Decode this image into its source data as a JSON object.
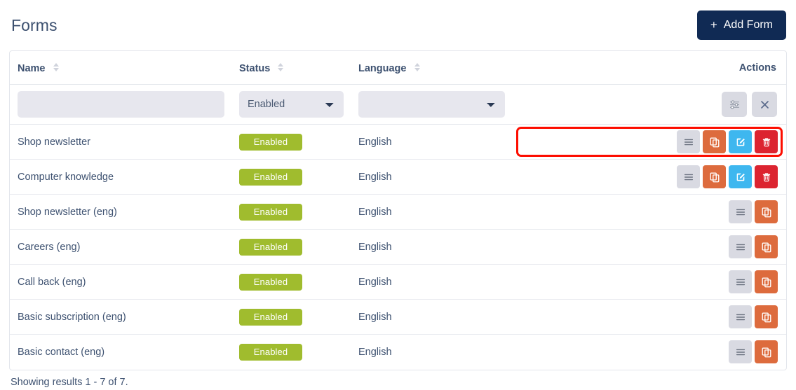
{
  "header": {
    "title": "Forms",
    "add_button": {
      "label": "Add Form",
      "plus": "+",
      "color": "#102a54"
    }
  },
  "table": {
    "columns": [
      {
        "key": "name",
        "label": "Name",
        "sortable": true
      },
      {
        "key": "status",
        "label": "Status",
        "sortable": true
      },
      {
        "key": "language",
        "label": "Language",
        "sortable": true
      },
      {
        "key": "actions",
        "label": "Actions",
        "sortable": false
      }
    ],
    "filters": {
      "name": {
        "value": "",
        "placeholder": ""
      },
      "status": {
        "value": "Enabled",
        "options": [
          "Enabled"
        ]
      },
      "language": {
        "value": "",
        "options": [
          ""
        ]
      },
      "apply_button_icon": "sliders-icon",
      "clear_button_icon": "close-icon"
    },
    "rows": [
      {
        "name": "Shop newsletter",
        "status": "Enabled",
        "language": "English",
        "highlighted": true,
        "actions": [
          "menu",
          "copy",
          "edit",
          "delete"
        ]
      },
      {
        "name": "Computer knowledge",
        "status": "Enabled",
        "language": "English",
        "highlighted": false,
        "actions": [
          "menu",
          "copy",
          "edit",
          "delete"
        ]
      },
      {
        "name": "Shop newsletter (eng)",
        "status": "Enabled",
        "language": "English",
        "highlighted": false,
        "actions": [
          "menu",
          "copy"
        ]
      },
      {
        "name": "Careers (eng)",
        "status": "Enabled",
        "language": "English",
        "highlighted": false,
        "actions": [
          "menu",
          "copy"
        ]
      },
      {
        "name": "Call back (eng)",
        "status": "Enabled",
        "language": "English",
        "highlighted": false,
        "actions": [
          "menu",
          "copy"
        ]
      },
      {
        "name": "Basic subscription (eng)",
        "status": "Enabled",
        "language": "English",
        "highlighted": false,
        "actions": [
          "menu",
          "copy"
        ]
      },
      {
        "name": "Basic contact (eng)",
        "status": "Enabled",
        "language": "English",
        "highlighted": false,
        "actions": [
          "menu",
          "copy"
        ]
      }
    ]
  },
  "footer": {
    "results_text": "Showing results 1 - 7 of 7."
  },
  "colors": {
    "badge_enabled": "#a0bc2e",
    "action_menu": "#d9dae2",
    "action_copy": "#dd6b3d",
    "action_edit": "#3eb7ef",
    "action_delete": "#dc2430",
    "highlight_outline": "#fd0d00",
    "text": "#3d5170"
  }
}
